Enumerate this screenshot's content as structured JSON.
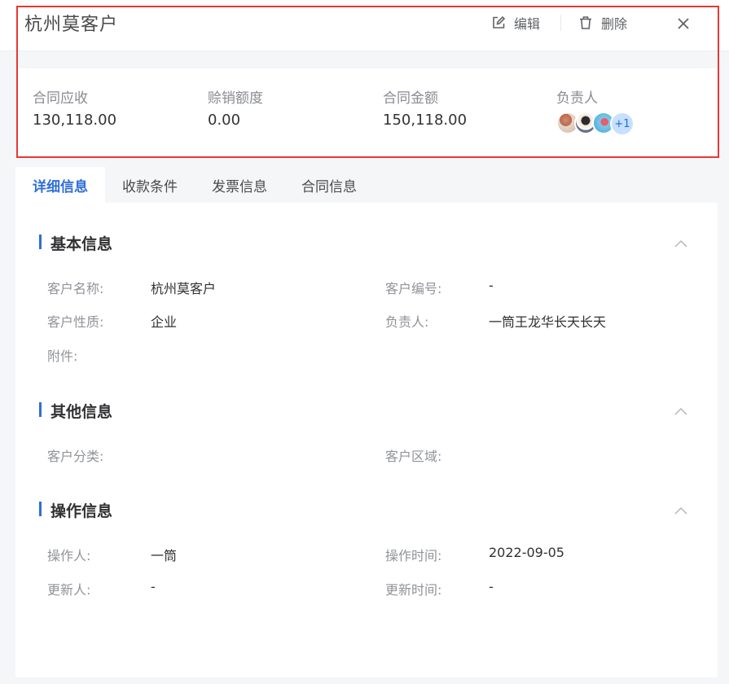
{
  "header": {
    "title": "杭州莫客户",
    "edit_label": "编辑",
    "delete_label": "删除"
  },
  "summary": {
    "receivable_label": "合同应收",
    "receivable_value": "130,118.00",
    "writeoff_label": "赊销额度",
    "writeoff_value": "0.00",
    "amount_label": "合同金额",
    "amount_value": "150,118.00",
    "owner_label": "负责人",
    "owner_more": "+1"
  },
  "tabs": [
    "详细信息",
    "收款条件",
    "发票信息",
    "合同信息"
  ],
  "sections": {
    "basic": {
      "title": "基本信息",
      "customer_name_label": "客户名称:",
      "customer_name": "杭州莫客户",
      "customer_no_label": "客户编号:",
      "customer_no": "-",
      "customer_type_label": "客户性质:",
      "customer_type": "企业",
      "owner_label": "负责人:",
      "owner": "一筒王龙华长天长天",
      "attachment_label": "附件:"
    },
    "other": {
      "title": "其他信息",
      "category_label": "客户分类:",
      "region_label": "客户区域:"
    },
    "operation": {
      "title": "操作信息",
      "operator_label": "操作人:",
      "operator": "一筒",
      "op_time_label": "操作时间:",
      "op_time": "2022-09-05",
      "updater_label": "更新人:",
      "updater": "-",
      "update_time_label": "更新时间:",
      "update_time": "-"
    }
  },
  "colors": {
    "accent": "#2f6fd6",
    "highlight": "#e53935"
  }
}
